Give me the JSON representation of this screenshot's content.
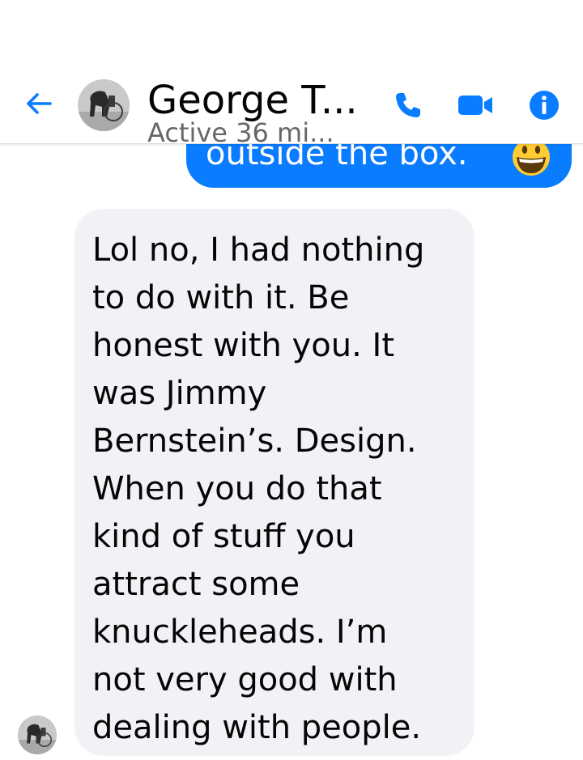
{
  "header": {
    "contact_name": "George T...",
    "status": "Active 36 mi..."
  },
  "messages": {
    "outgoing_visible_text": "outside the box.",
    "outgoing_emoji": "grinning-face-emoji",
    "incoming_text": "Lol no, I had nothing\nto do with it. Be\nhonest with you. It\nwas Jimmy\nBernstein’s. Design.\nWhen you do that\nkind of stuff you\nattract some\nknuckleheads. I’m\nnot very good with\ndealing with people."
  },
  "colors": {
    "accent": "#0a7cff",
    "incoming_bubble": "#f0f2f5",
    "text": "#050505",
    "status_text": "#65676b"
  },
  "icons": {
    "back": "back-arrow-icon",
    "call": "phone-icon",
    "video": "video-camera-icon",
    "info": "info-icon"
  }
}
